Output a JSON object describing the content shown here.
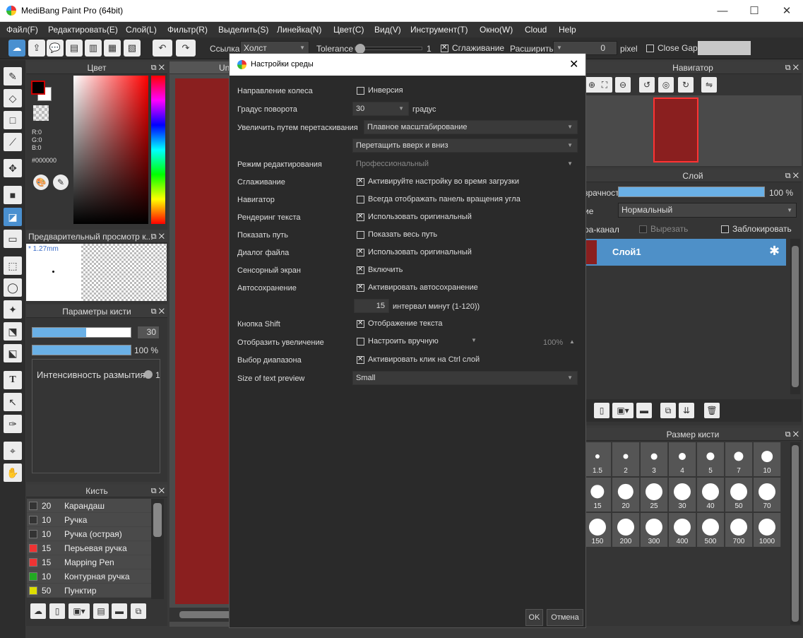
{
  "window": {
    "title": "MediBang Paint Pro (64bit)"
  },
  "menu": [
    "Файл(F)",
    "Редактировать(E)",
    "Слой(L)",
    "Фильтр(R)",
    "Выделить(S)",
    "Линейка(N)",
    "Цвет(C)",
    "Вид(V)",
    "Инструмент(T)",
    "Окно(W)",
    "Cloud",
    "Help"
  ],
  "toolbar": {
    "ref_label": "Ссылка",
    "ref_value": "Холст",
    "tolerance_label": "Tolerance",
    "tolerance_value": "1",
    "smooth_label": "Сглаживание",
    "expand_label": "Расширить",
    "expand_value": "0",
    "expand_unit": "pixel",
    "close_gaps": "Close Gaps",
    "tolerance_level": 0.02
  },
  "color_panel": {
    "title": "Цвет",
    "r": "R:0",
    "g": "G:0",
    "b": "B:0",
    "hex": "#000000",
    "fg": "#000000",
    "bg": "#ffffff"
  },
  "preview_panel": {
    "title": "Предварительный просмотр к...",
    "size": "* 1.27mm"
  },
  "brush_params": {
    "title": "Параметры кисти",
    "size_value": "30",
    "opacity_value": "100 %",
    "blur_label": "Интенсивность размытия",
    "blur_value": "1",
    "size_level": 0.55,
    "opacity_level": 1.0
  },
  "brush_panel": {
    "title": "Кисть",
    "items": [
      {
        "size": "20",
        "name": "Карандаш",
        "color": "#333333"
      },
      {
        "size": "10",
        "name": "Ручка",
        "color": "#333333"
      },
      {
        "size": "10",
        "name": "Ручка (острая)",
        "color": "#333333"
      },
      {
        "size": "15",
        "name": "Перьевая ручка",
        "color": "#ee3333"
      },
      {
        "size": "15",
        "name": "Mapping Pen",
        "color": "#ee3333"
      },
      {
        "size": "10",
        "name": "Контурная ручка",
        "color": "#22aa22"
      },
      {
        "size": "50",
        "name": "Пунктир",
        "color": "#dddd00"
      }
    ]
  },
  "canvas": {
    "tab": "Un"
  },
  "navigator": {
    "title": "Навигатор"
  },
  "layer_panel": {
    "title": "Слой",
    "opacity_label": "зрачность",
    "opacity_value": "100 %",
    "blend_label": "ие",
    "blend_value": "Нормальный",
    "alpha_label": "ра-канал",
    "clip_label": "Вырезать",
    "lock_label": "Заблокировать",
    "layer_name": "Слой1",
    "opacity_level": 1.0
  },
  "brush_size_panel": {
    "title": "Размер кисти",
    "sizes": [
      "1.5",
      "2",
      "3",
      "4",
      "5",
      "7",
      "10",
      "15",
      "20",
      "25",
      "30",
      "40",
      "50",
      "70",
      "150",
      "200",
      "300",
      "400",
      "500",
      "700",
      "1000"
    ]
  },
  "dialog": {
    "title": "Настройки среды",
    "wheel_dir_label": "Направление колеса",
    "wheel_dir_value": "Инверсия",
    "rotation_label": "Градус поворота",
    "rotation_value": "30",
    "rotation_unit": "градус",
    "drag_zoom_label": "Увеличить путем перетаскивания",
    "drag_zoom_value": "Плавное масштабирование",
    "drag_zoom_value2": "Перетащить вверх и вниз",
    "edit_mode_label": "Режим редактирования",
    "edit_mode_value": "Профессиональный",
    "smoothing_label": "Сглаживание",
    "smoothing_value": "Активируйте настройку во время загрузки",
    "navigator_label": "Навигатор",
    "navigator_value": "Всегда отображать панель вращения угла",
    "text_render_label": "Рендеринг текста",
    "text_render_value": "Использовать оригинальный",
    "show_path_label": "Показать путь",
    "show_path_value": "Показать весь путь",
    "file_dialog_label": "Диалог файла",
    "file_dialog_value": "Использовать оригинальный",
    "touch_label": "Сенсорный экран",
    "touch_value": "Включить",
    "autosave_label": "Автосохранение",
    "autosave_value": "Активировать автосохранение",
    "autosave_interval": "15",
    "autosave_interval_label": "интервал минут (1-120))",
    "shift_label": "Кнопка Shift",
    "shift_value": "Отображение текста",
    "zoom_display_label": "Отобразить увеличение",
    "zoom_display_value": "Настроить вручную",
    "zoom_display_pct": "100%",
    "range_label": "Выбор диапазона",
    "range_value": "Активировать клик на Ctrl слой",
    "text_preview_label": "Size of text preview",
    "text_preview_value": "Small",
    "ok": "OK",
    "cancel": "Отмена"
  }
}
